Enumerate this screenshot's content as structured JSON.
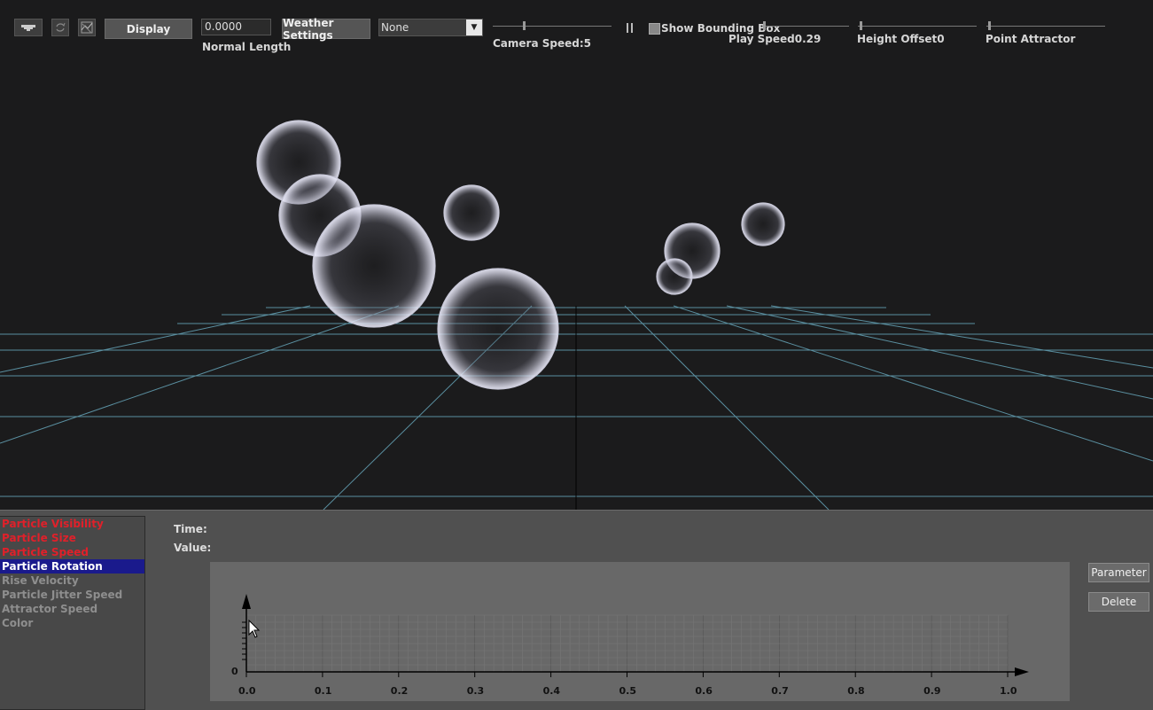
{
  "toolbar": {
    "icons": [
      "stage-icon",
      "refresh-icon",
      "graph-icon"
    ],
    "display_label": "Display",
    "normal_length_value": "0.0000",
    "normal_length_label": "Normal Length",
    "weather_settings_label": "Weather Settings",
    "preset_selected": "None",
    "camera_speed_label": "Camera Speed:5",
    "show_bounding_box_label": "Show Bounding Box",
    "show_bounding_box_checked": false,
    "play_speed_label": "Play Speed0.29",
    "height_offset_label": "Height Offset0",
    "point_attractor_label": "Point Attractor"
  },
  "viewport": {
    "grid_color": "#5a8fa0",
    "background": "#1b1b1c"
  },
  "params": {
    "items": [
      {
        "label": "Particle Visibility",
        "state": "red"
      },
      {
        "label": "Particle Size",
        "state": "red"
      },
      {
        "label": "Particle Speed",
        "state": "red"
      },
      {
        "label": "Particle Rotation",
        "state": "selected"
      },
      {
        "label": "Rise Velocity",
        "state": "gray"
      },
      {
        "label": "Particle Jitter Speed",
        "state": "gray"
      },
      {
        "label": "Attractor Speed",
        "state": "gray"
      },
      {
        "label": "Color",
        "state": "gray"
      }
    ]
  },
  "graph": {
    "time_label": "Time:",
    "value_label": "Value:",
    "y_tick_label": "0",
    "x_ticks": [
      "0.0",
      "0.1",
      "0.2",
      "0.3",
      "0.4",
      "0.5",
      "0.6",
      "0.7",
      "0.8",
      "0.9",
      "1.0"
    ]
  },
  "buttons": {
    "parameter_label": "Parameter",
    "delete_label": "Delete"
  }
}
